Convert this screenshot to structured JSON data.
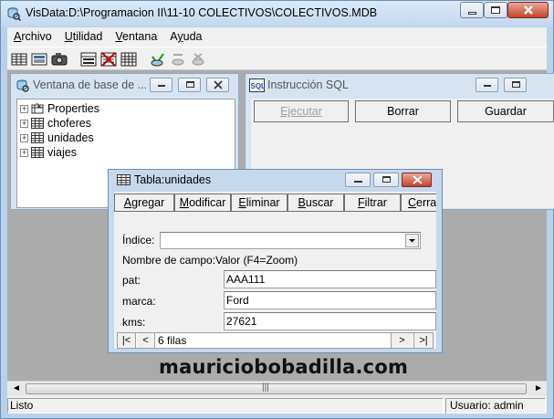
{
  "window": {
    "title": "VisData:D:\\Programacion II\\11-10 COLECTIVOS\\COLECTIVOS.MDB"
  },
  "menu": [
    {
      "key": "A",
      "rest": "rchivo"
    },
    {
      "key": "U",
      "rest": "tilidad"
    },
    {
      "key": "V",
      "rest": "entana",
      "prefix": ""
    },
    {
      "key": "y",
      "prefix": "A",
      "rest": "uda"
    }
  ],
  "menu_labels": {
    "m0a": "A",
    "m0b": "rchivo",
    "m1a": "U",
    "m1b": "tilidad",
    "m2a": "V",
    "m2b": "entana",
    "m3a": "A",
    "m3b": "y",
    "m3c": "uda"
  },
  "db_window": {
    "title": "Ventana de base de ...",
    "tree": [
      {
        "label": "Properties",
        "icon": "properties-icon"
      },
      {
        "label": "choferes",
        "icon": "table-icon"
      },
      {
        "label": "unidades",
        "icon": "table-icon"
      },
      {
        "label": "viajes",
        "icon": "table-icon"
      }
    ]
  },
  "sql_window": {
    "title": "Instrucción SQL",
    "execute_label": "Ejecutar",
    "delete_label": "Borrar",
    "save_label": "Guardar"
  },
  "table_window": {
    "title": "Tabla:unidades",
    "buttons": {
      "add": [
        "A",
        "gregar"
      ],
      "modify": [
        "M",
        "odificar"
      ],
      "remove": [
        "E",
        "liminar"
      ],
      "search": [
        "B",
        "uscar"
      ],
      "filter": [
        "F",
        "iltrar"
      ],
      "close": [
        "C",
        "erra"
      ]
    },
    "index_label": "Índice:",
    "index_value": "",
    "field_name_header": "Nombre de campo:",
    "value_header": "Valor (F4=Zoom)",
    "fields": [
      {
        "name": "pat:",
        "value": "AAA111"
      },
      {
        "name": "marca:",
        "value": "Ford"
      },
      {
        "name": "kms:",
        "value": "27621"
      }
    ],
    "record_count": "6 filas"
  },
  "watermark": "mauriciobobadilla.com",
  "status": {
    "left": "Listo",
    "user": "Usuario: admin"
  },
  "colors": {
    "title_bg": "#c2d8ee",
    "close_red": "#c7432b",
    "mdi_gray": "#ababab"
  }
}
